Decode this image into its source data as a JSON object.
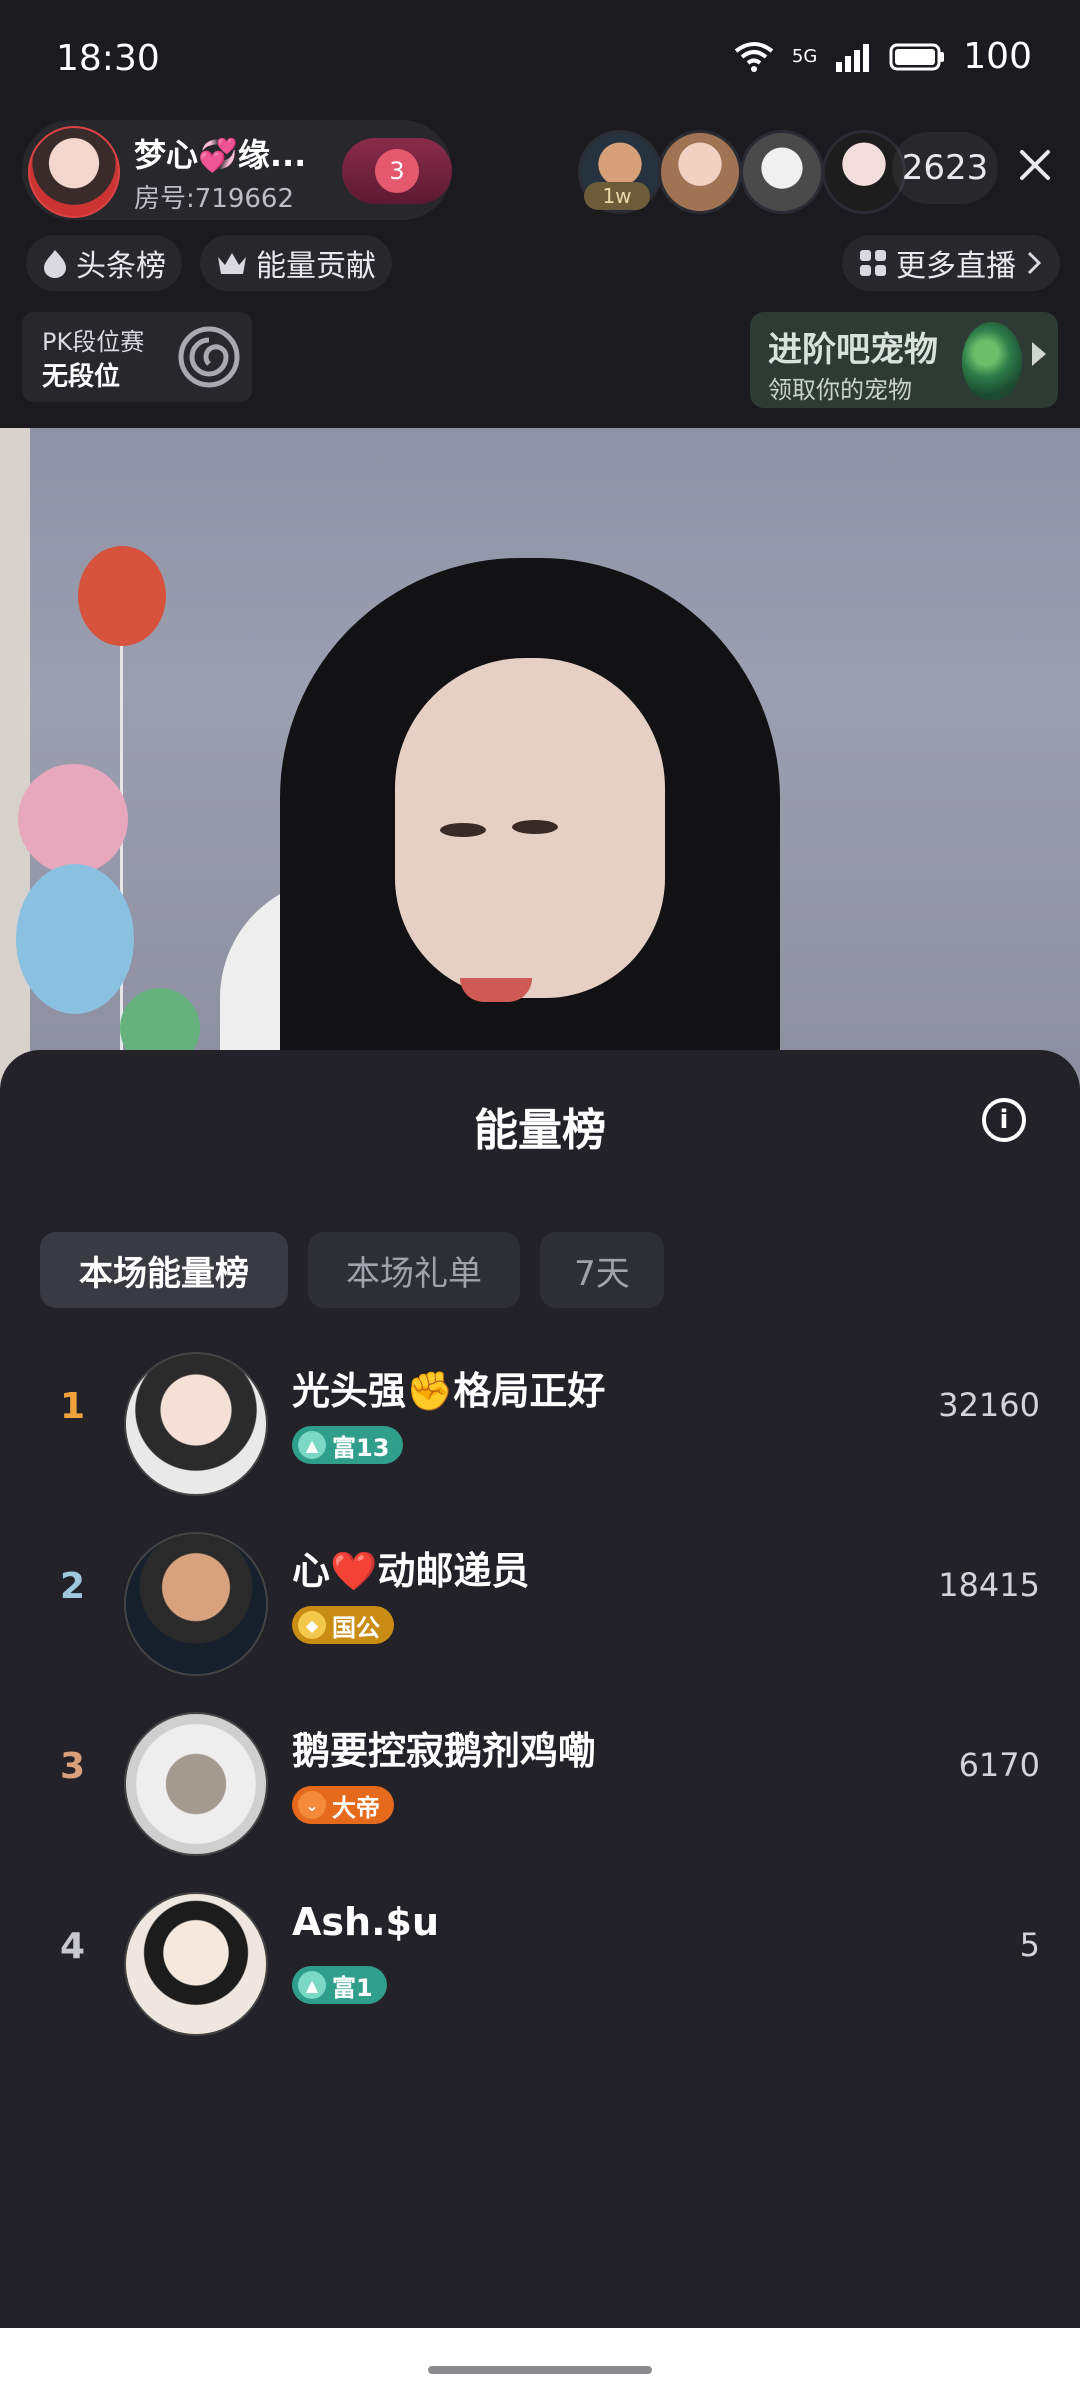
{
  "status_bar": {
    "time": "18:30",
    "network": "5G",
    "battery": "100"
  },
  "header": {
    "host_name": "梦心💞缘...",
    "room_id": "房号:719662",
    "fan_level": "3",
    "viewer_tag": "1w",
    "viewer_count": "2623",
    "close_icon": "close-icon"
  },
  "nav_chips": {
    "headline": "头条榜",
    "energy_contribution": "能量贡献",
    "more_live": "更多直播"
  },
  "pk_card": {
    "title": "PK段位赛",
    "rank": "无段位"
  },
  "pet_card": {
    "title": "进阶吧宠物",
    "subtitle": "领取你的宠物"
  },
  "sheet": {
    "title": "能量榜",
    "tabs": [
      {
        "label": "本场能量榜",
        "active": true
      },
      {
        "label": "本场礼单",
        "active": false
      },
      {
        "label": "7天",
        "active": false
      }
    ],
    "rows": [
      {
        "rank": "1",
        "name": "光头强✊格局正好",
        "badge": "富13",
        "score": "32160",
        "rank_color": "#f0a33b"
      },
      {
        "rank": "2",
        "name": "心❤️动邮递员",
        "badge": "国公",
        "score": "18415",
        "rank_color": "#9ec8e0"
      },
      {
        "rank": "3",
        "name": "鹅要控寂鹅剂鸡嘞",
        "badge": "大帝",
        "score": "6170",
        "rank_color": "#d9a07a"
      },
      {
        "rank": "4",
        "name": "Ash.$u",
        "badge": "富1",
        "score": "5",
        "rank_color": "#c8c8cf"
      }
    ]
  }
}
